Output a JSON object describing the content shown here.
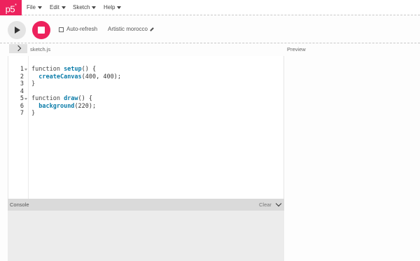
{
  "nav": {
    "logo": "p5",
    "logo_sup": "*",
    "menus": [
      {
        "label": "File"
      },
      {
        "label": "Edit"
      },
      {
        "label": "Sketch"
      },
      {
        "label": "Help"
      }
    ]
  },
  "toolbar": {
    "auto_refresh_label": "Auto-refresh",
    "auto_refresh_checked": false,
    "sketch_name": "Artistic morocco"
  },
  "editor": {
    "file_tab": "sketch.js",
    "preview_label": "Preview",
    "line_numbers": [
      "1",
      "2",
      "3",
      "4",
      "5",
      "6",
      "7"
    ],
    "lines": [
      {
        "kw": "function ",
        "fn": "setup",
        "rest": "() {"
      },
      {
        "kw": "  ",
        "fn": "createCanvas",
        "rest": "(400, 400);"
      },
      {
        "kw": "}",
        "fn": "",
        "rest": ""
      },
      {
        "kw": "",
        "fn": "",
        "rest": ""
      },
      {
        "kw": "function ",
        "fn": "draw",
        "rest": "() {"
      },
      {
        "kw": "  ",
        "fn": "background",
        "rest": "(220);"
      },
      {
        "kw": "}",
        "fn": "",
        "rest": ""
      }
    ]
  },
  "console": {
    "label": "Console",
    "clear_label": "Clear"
  },
  "colors": {
    "brand": "#ed225d",
    "function_name": "#0b7ca9"
  }
}
